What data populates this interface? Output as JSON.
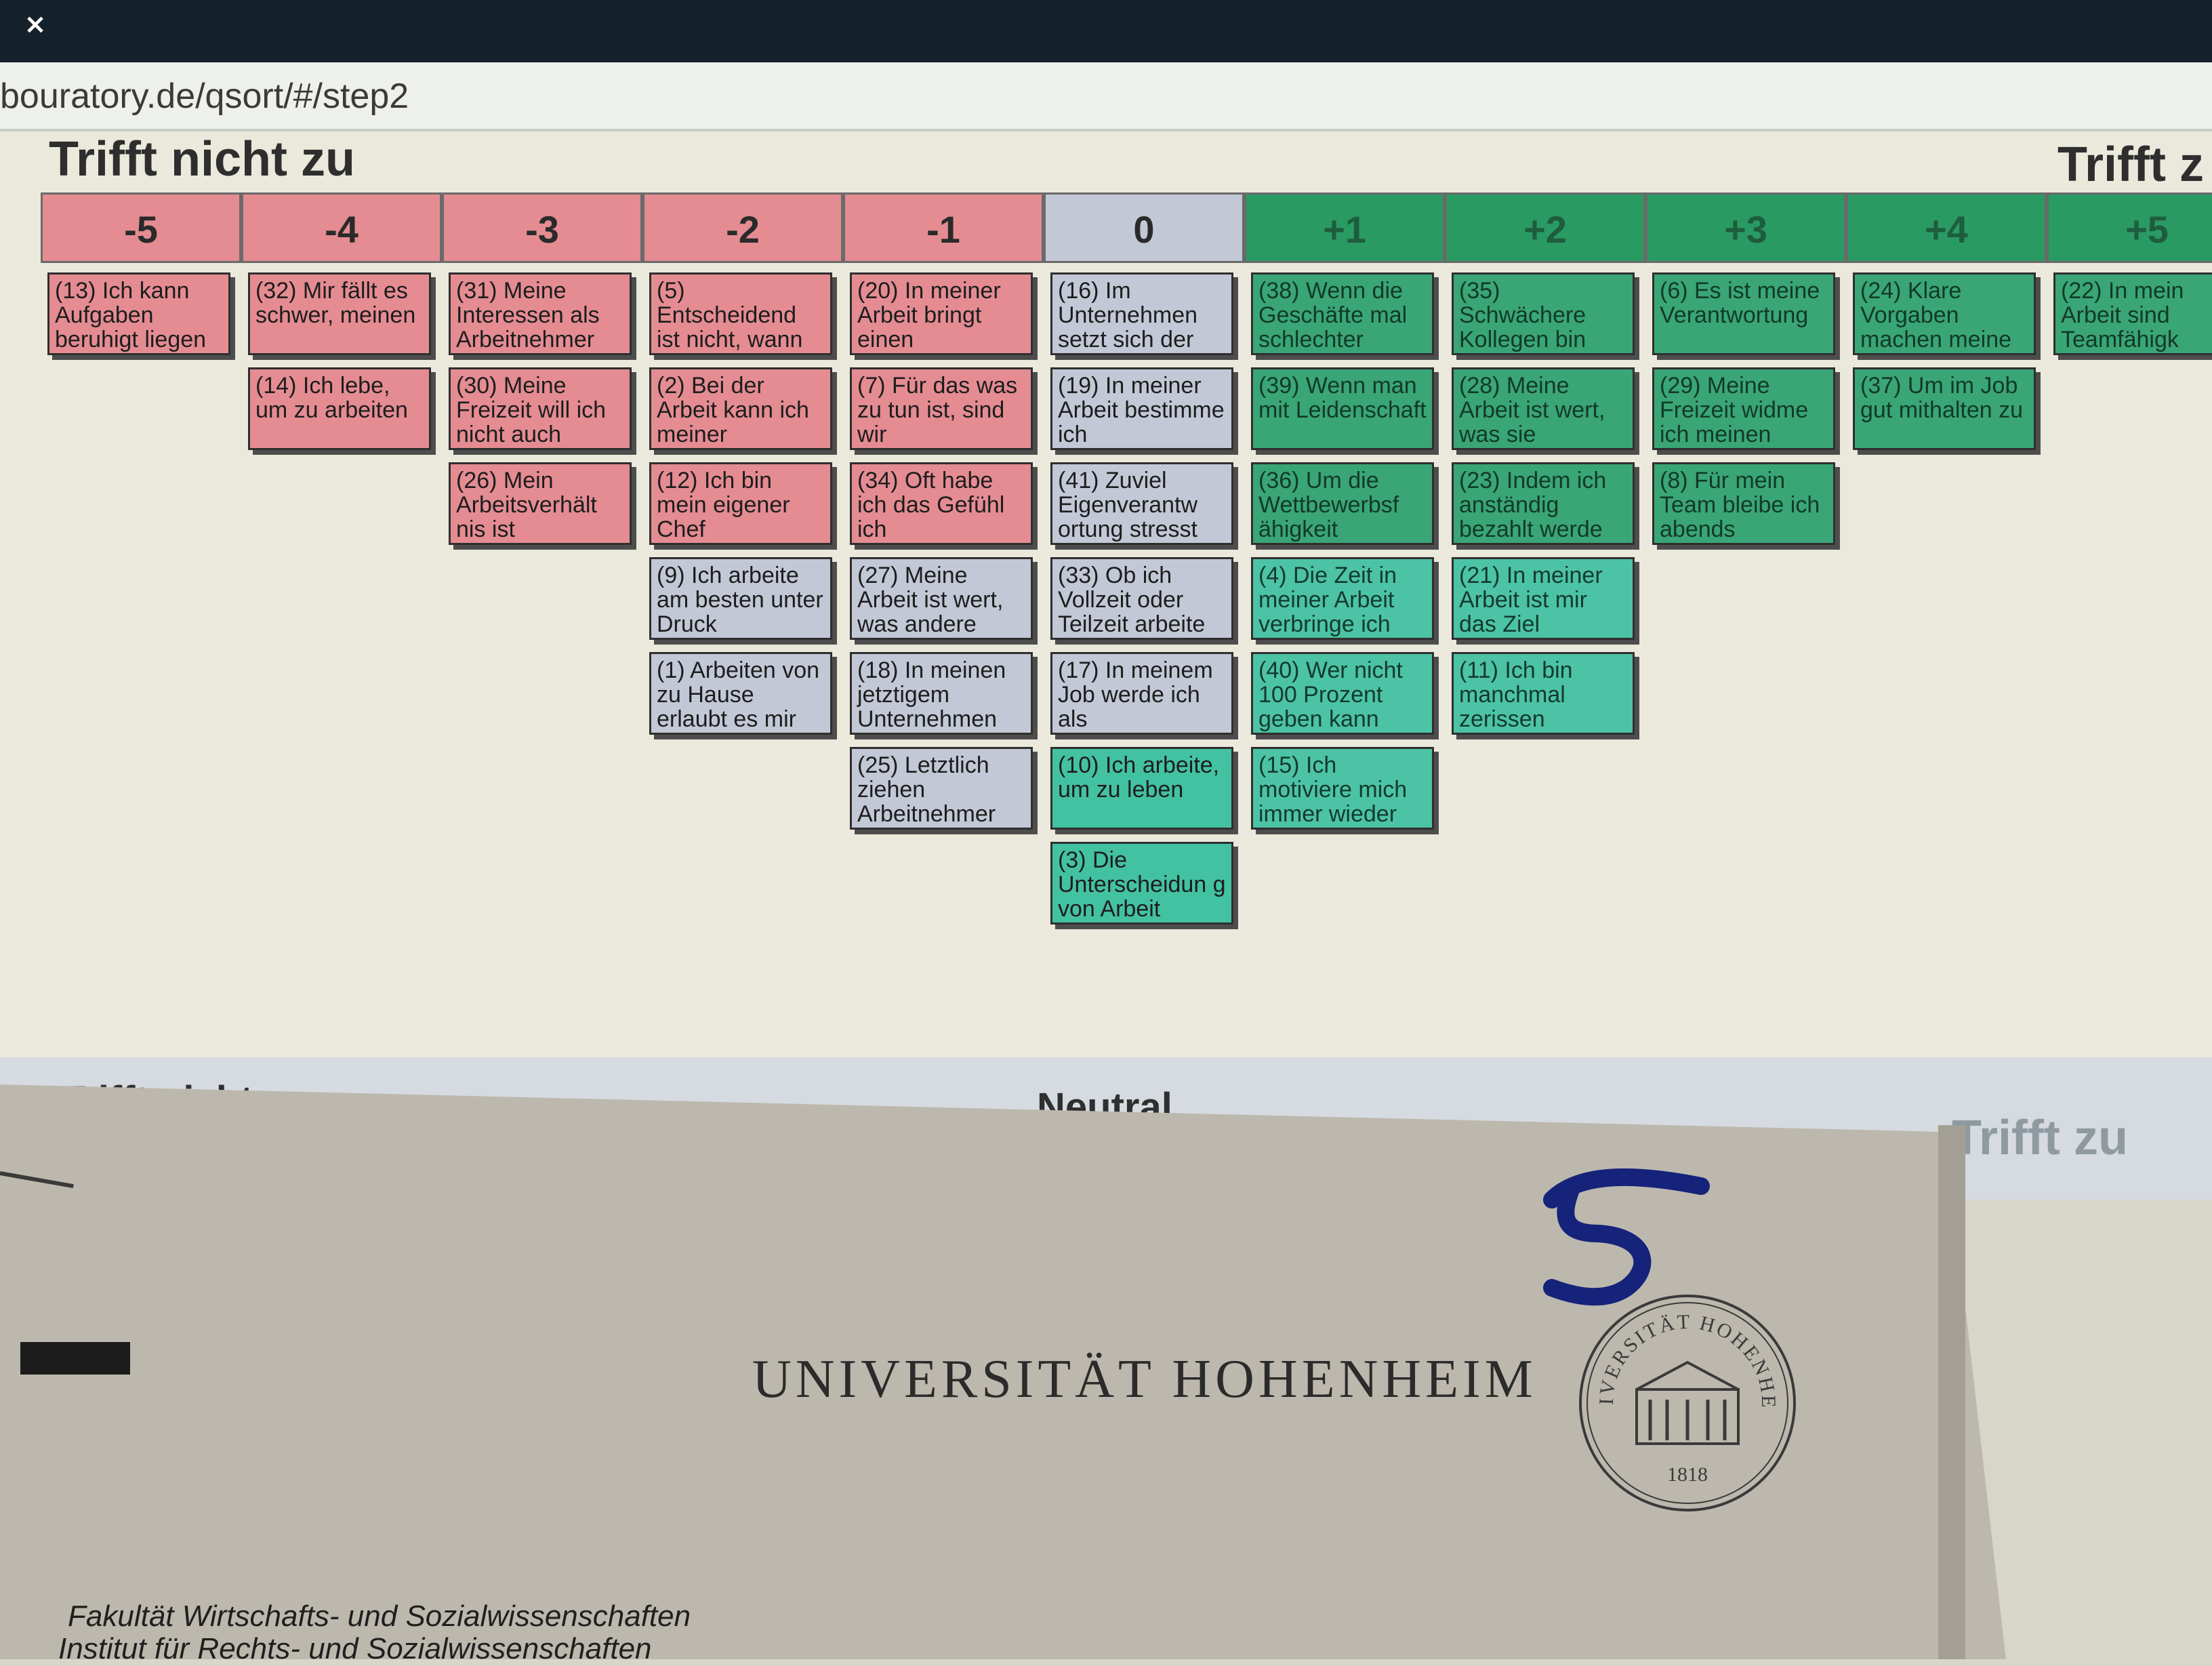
{
  "browser": {
    "close_icon": "×",
    "url": "bouratory.de/qsort/#/step2"
  },
  "sort": {
    "heading_left": "Trifft nicht zu",
    "heading_right": "Trifft z",
    "columns": [
      {
        "label": "-5",
        "tone": "neg",
        "cards": [
          {
            "text": "(13) Ich kann Aufgaben beruhigt liegen"
          }
        ]
      },
      {
        "label": "-4",
        "tone": "neg",
        "cards": [
          {
            "text": "(32) Mir fällt es schwer, meinen"
          },
          {
            "text": "(14) Ich lebe, um zu arbeiten"
          }
        ]
      },
      {
        "label": "-3",
        "tone": "neg",
        "cards": [
          {
            "text": "(31) Meine Interessen als Arbeitnehmer"
          },
          {
            "text": "(30) Meine Freizeit will ich nicht auch"
          },
          {
            "text": "(26) Mein Arbeitsverhält nis ist"
          }
        ]
      },
      {
        "label": "-2",
        "tone": "neg",
        "cards": [
          {
            "text": "(5) Entscheidend ist nicht, wann"
          },
          {
            "text": "(2) Bei der Arbeit kann ich meiner"
          },
          {
            "text": "(12) Ich bin mein eigener Chef"
          },
          {
            "text": "(9) Ich arbeite am besten unter Druck",
            "tone": "neu"
          },
          {
            "text": "(1) Arbeiten von zu Hause erlaubt es mir",
            "tone": "neu"
          }
        ]
      },
      {
        "label": "-1",
        "tone": "neg",
        "cards": [
          {
            "text": "(20) In meiner Arbeit bringt einen"
          },
          {
            "text": "(7) Für das was zu tun ist, sind wir"
          },
          {
            "text": "(34) Oft habe ich das Gefühl ich"
          },
          {
            "text": "(27) Meine Arbeit ist wert, was andere",
            "tone": "neu"
          },
          {
            "text": "(18) In meinen jetztigem Unternehmen",
            "tone": "neu"
          },
          {
            "text": "(25) Letztlich ziehen Arbeitnehmer",
            "tone": "neu"
          }
        ]
      },
      {
        "label": "0",
        "tone": "neu",
        "cards": [
          {
            "text": "(16) Im Unternehmen setzt sich der"
          },
          {
            "text": "(19) In meiner Arbeit bestimme ich"
          },
          {
            "text": "(41) Zuviel Eigenverantw ortung stresst"
          },
          {
            "text": "(33) Ob ich Vollzeit oder Teilzeit arbeite"
          },
          {
            "text": "(17) In meinem Job werde ich als"
          },
          {
            "text": "(10) Ich arbeite, um zu leben",
            "teal": true
          },
          {
            "text": "(3) Die Unterscheidun g von Arbeit",
            "teal": true
          }
        ]
      },
      {
        "label": "+1",
        "tone": "pos",
        "cards": [
          {
            "text": "(38) Wenn die Geschäfte mal schlechter"
          },
          {
            "text": "(39) Wenn man mit Leidenschaft"
          },
          {
            "text": "(36) Um die Wettbewerbsf ähigkeit"
          },
          {
            "text": "(4) Die Zeit in meiner Arbeit verbringe ich",
            "teal": true
          },
          {
            "text": "(40) Wer nicht 100 Prozent geben kann",
            "teal": true
          },
          {
            "text": "(15) Ich motiviere mich immer wieder",
            "teal": true
          }
        ]
      },
      {
        "label": "+2",
        "tone": "pos",
        "cards": [
          {
            "text": "(35) Schwächere Kollegen bin"
          },
          {
            "text": "(28) Meine Arbeit ist wert, was sie"
          },
          {
            "text": "(23) Indem ich anständig bezahlt werde"
          },
          {
            "text": "(21) In meiner Arbeit ist mir das Ziel",
            "teal": true
          },
          {
            "text": "(11) Ich bin manchmal zerissen",
            "teal": true
          }
        ]
      },
      {
        "label": "+3",
        "tone": "pos",
        "cards": [
          {
            "text": "(6) Es ist meine Verantwortung"
          },
          {
            "text": "(29) Meine Freizeit widme ich meinen"
          },
          {
            "text": "(8) Für mein Team bleibe ich abends"
          }
        ]
      },
      {
        "label": "+4",
        "tone": "pos",
        "cards": [
          {
            "text": "(24) Klare Vorgaben machen meine"
          },
          {
            "text": "(37) Um im Job gut mithalten zu"
          }
        ]
      },
      {
        "label": "+5",
        "tone": "pos",
        "cards": [
          {
            "text": "(22) In mein Arbeit sind Teamfähigk"
          }
        ]
      }
    ],
    "footer_left": "Trifft nicht zu",
    "footer_center": "Neutral",
    "footer_right": "Trifft zu"
  },
  "letterhead": {
    "handwritten_number": "5",
    "university": "UNIVERSITÄT HOHENHEIM",
    "seal_text": "UNIVERSITÄT HOHENHEIM",
    "seal_year": "1818",
    "faculty": "Fakultät Wirtschafts- und Sozialwissenschaften",
    "institute": "Institut für Rechts- und Sozialwissenschaften"
  }
}
